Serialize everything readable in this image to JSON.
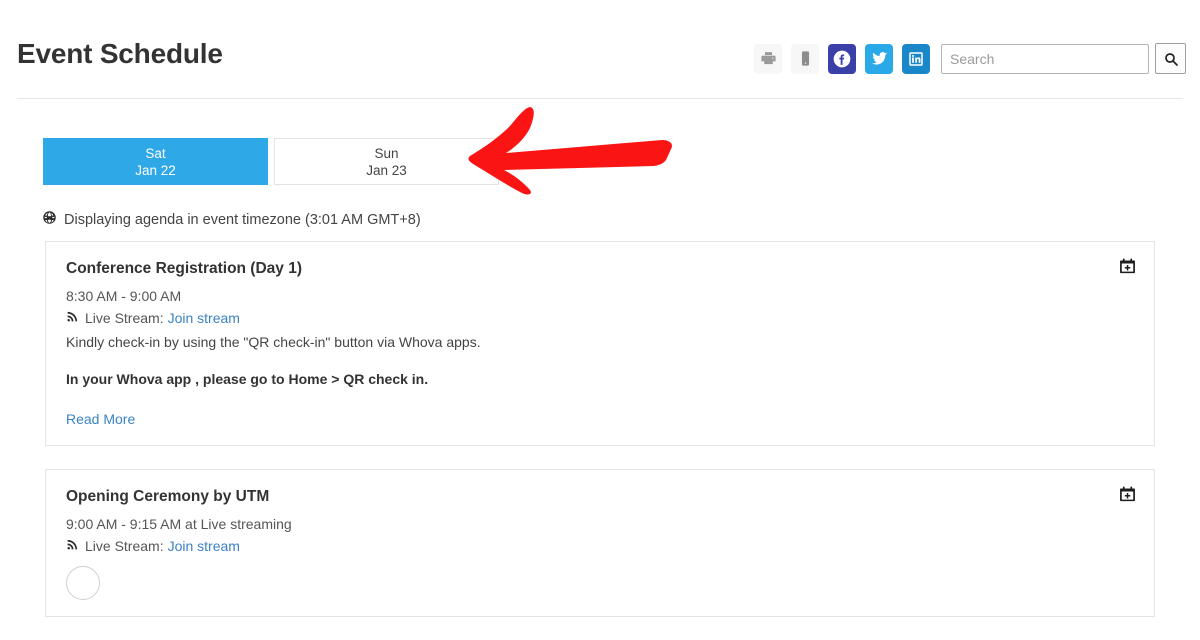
{
  "header": {
    "title": "Event Schedule",
    "tools": [
      {
        "name": "print-icon",
        "label": "Print"
      },
      {
        "name": "mobile-icon",
        "label": "Mobile"
      },
      {
        "name": "facebook-icon",
        "label": "Facebook",
        "color": "#3b3fa8"
      },
      {
        "name": "twitter-icon",
        "label": "Twitter",
        "color": "#2aa9e8"
      },
      {
        "name": "linkedin-icon",
        "label": "LinkedIn",
        "color": "#1a87c9"
      }
    ],
    "search": {
      "placeholder": "Search",
      "value": "",
      "button_icon": "search-icon"
    }
  },
  "tabs": [
    {
      "day": "Sat",
      "date": "Jan 22",
      "active": true
    },
    {
      "day": "Sun",
      "date": "Jan 23",
      "active": false
    }
  ],
  "timezone_note": {
    "icon": "globe-icon",
    "text": "Displaying agenda in event timezone (3:01 AM GMT+8)"
  },
  "sessions": [
    {
      "title": "Conference Registration (Day 1)",
      "time": "8:30 AM - 9:00 AM",
      "stream_label": "Live Stream:",
      "stream_link": "Join stream",
      "description": "Kindly check-in by using the \"QR check-in\" button via Whova apps.",
      "note": "In your Whova app , please go to Home > QR check in.",
      "read_more": "Read More",
      "calendar_icon": "calendar-plus-icon"
    },
    {
      "title": "Opening Ceremony by UTM",
      "time": "9:00 AM - 9:15 AM at Live streaming",
      "stream_label": "Live Stream:",
      "stream_link": "Join stream",
      "calendar_icon": "calendar-plus-icon"
    }
  ],
  "annotation": {
    "name": "red-arrow-annotation",
    "color": "#fa1414",
    "direction": "left",
    "points_at": "Sun Jan 23 tab"
  },
  "colors": {
    "accent_blue": "#2fa8e8",
    "link_blue": "#3b82c4",
    "annotation_red": "#fa1414"
  }
}
